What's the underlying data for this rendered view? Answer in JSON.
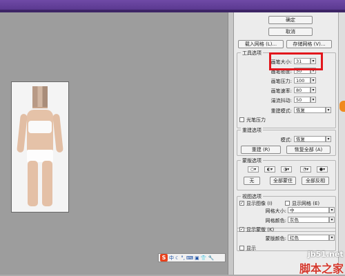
{
  "panel": {
    "ok_label": "确定",
    "cancel_label": "取消",
    "load_mesh_label": "载入网格 (L)...",
    "save_mesh_label": "存储网格 (V)...",
    "tool_options_title": "工具选项",
    "brush_size_label": "画笔大小:",
    "brush_size_value": "31",
    "brush_density_label": "画笔密度:",
    "brush_density_value": "50",
    "brush_pressure_label": "画笔压力:",
    "brush_pressure_value": "100",
    "brush_rate_label": "画笔速率:",
    "brush_rate_value": "80",
    "turbulent_jitter_label": "湍流抖动:",
    "turbulent_jitter_value": "50",
    "rebuild_mode_label": "重建模式:",
    "rebuild_mode_value": "恢复",
    "stylus_pressure_label": "光笔压力",
    "rebuild_options_title": "重建选项",
    "mode_label": "模式:",
    "mode_value": "恢复",
    "rebuild_button": "重建 (R)",
    "restore_all_button": "恢复全部 (A)",
    "mask_options_title": "蒙版选项",
    "none_button": "无",
    "mask_all_button": "全部蒙住",
    "invert_all_button": "全部反相",
    "view_options_title": "视图选项",
    "show_image_label": "显示图像 (I)",
    "show_mesh_label": "显示网格 (E)",
    "mesh_size_label": "网格大小:",
    "mesh_size_value": "中",
    "mesh_color_label": "网格颜色:",
    "mesh_color_value": "灰色",
    "show_mask_label": "显示蒙版 (K)",
    "mask_color_label": "蒙版颜色:",
    "mask_color_value": "红色",
    "show_backdrop_label": "显示"
  },
  "ime": {
    "logo": "S",
    "mode": "中"
  },
  "watermark": {
    "site": "jb51.net",
    "name": "脚本之家"
  },
  "colors": {
    "highlight_box": "#e2161c",
    "title_bar": "#55348a"
  }
}
